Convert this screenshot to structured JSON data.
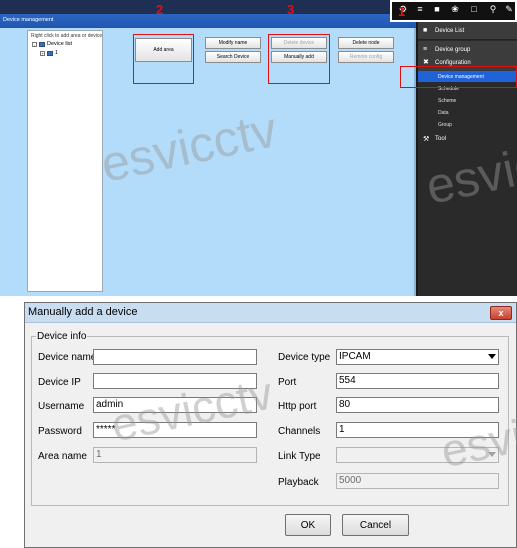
{
  "top_window": {
    "title": "Device management",
    "tree_hint": "Right click to add area or device",
    "tree_root": "Device list",
    "tree_child": "1",
    "buttons": {
      "add_area": "Add area",
      "modify_name": "Modify name",
      "search_device": "Search Device",
      "delete_device": "Delete device",
      "manually_add": "Manually add",
      "delete_node": "Delete node",
      "remote_config": "Remote config"
    },
    "markers": {
      "step1": "1",
      "step2": "2",
      "step3": "3"
    }
  },
  "nav": {
    "device_list": "Device List",
    "device_group": "Device group",
    "configuration": "Configuration",
    "items": [
      "Device management",
      "Schedule",
      "Scheme",
      "Data",
      "Group"
    ],
    "active_item": "Device management",
    "tool": "Tool"
  },
  "toolbar_icons": [
    "settings-icon",
    "list-icon",
    "camera-icon",
    "palette-icon",
    "monitor-icon",
    "pin-icon",
    "wrench-icon"
  ],
  "dialog": {
    "title": "Manually add a device",
    "close_label": "x",
    "group_label": "Device info",
    "fields": {
      "device_name": {
        "label": "Device name",
        "value": ""
      },
      "device_ip": {
        "label": "Device IP",
        "value": ""
      },
      "username": {
        "label": "Username",
        "value": "admin"
      },
      "password": {
        "label": "Password",
        "value": "*****"
      },
      "area_name": {
        "label": "Area name",
        "value": "1"
      },
      "device_type": {
        "label": "Device type",
        "value": "IPCAM"
      },
      "port": {
        "label": "Port",
        "value": "554"
      },
      "http_port": {
        "label": "Http port",
        "value": "80"
      },
      "channels": {
        "label": "Channels",
        "value": "1"
      },
      "link_type": {
        "label": "Link Type",
        "value": ""
      },
      "playback": {
        "label": "Playback",
        "value": "5000"
      }
    },
    "ok_label": "OK",
    "cancel_label": "Cancel"
  },
  "watermark_text": "esvicctv",
  "colors": {
    "main_bg": "#b3dcfa",
    "nav_active": "#2063d8",
    "marker_red": "#e01010"
  }
}
